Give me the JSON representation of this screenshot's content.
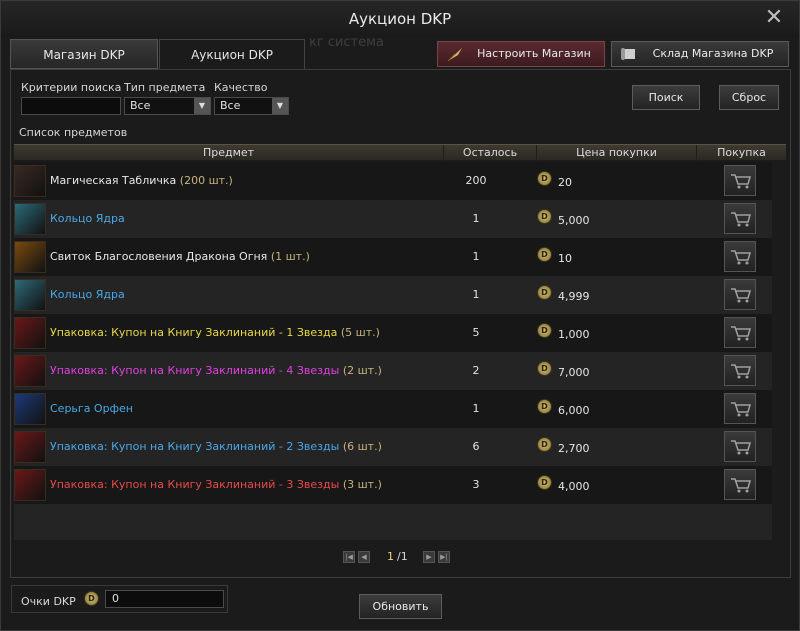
{
  "window": {
    "title": "Аукцион DKP"
  },
  "tabs": [
    {
      "label": "Магазин DKP"
    },
    {
      "label": "Аукцион DKP"
    }
  ],
  "ghost_text": "кг система",
  "toolbar": {
    "setup_label": "Настроить Магазин",
    "warehouse_label": "Склад Магазина DKP"
  },
  "filters": {
    "search_label": "Критерии поиска",
    "search_value": "",
    "type_label": "Тип предмета",
    "type_value": "Все",
    "quality_label": "Качество",
    "quality_value": "Все",
    "search_button": "Поиск",
    "reset_button": "Сброс"
  },
  "list": {
    "caption": "Список предметов",
    "headers": {
      "item": "Предмет",
      "remaining": "Осталось",
      "price": "Цена покупки",
      "buy": "Покупка"
    },
    "coin_symbol": "D",
    "rows": [
      {
        "name": "Магическая Табличка",
        "count": "(200 шт.)",
        "remaining": "200",
        "price": "20",
        "color": "#e8e8e8",
        "icon": "magic-tablet-icon",
        "icon_bg": "#3a2a22"
      },
      {
        "name": "Кольцо Ядра",
        "count": "",
        "remaining": "1",
        "price": "5,000",
        "color": "#4aa8e8",
        "icon": "core-ring-icon",
        "icon_bg": "#2c6a78"
      },
      {
        "name": "Свиток Благословения Дракона Огня",
        "count": "(1 шт.)",
        "remaining": "1",
        "price": "10",
        "color": "#e8e8e8",
        "icon": "fire-dragon-scroll-icon",
        "icon_bg": "#7a4a10"
      },
      {
        "name": "Кольцо Ядра",
        "count": "",
        "remaining": "1",
        "price": "4,999",
        "color": "#4aa8e8",
        "icon": "core-ring-icon",
        "icon_bg": "#2c6a78"
      },
      {
        "name": "Упаковка: Купон на Книгу Заклинаний - 1 Звезда",
        "count": "(5 шт.)",
        "remaining": "5",
        "price": "1,000",
        "color": "#e8d84a",
        "icon": "spellbook-coupon-icon",
        "icon_bg": "#6a1818"
      },
      {
        "name": "Упаковка: Купон на Книгу Заклинаний - 4 Звезды",
        "count": "(2 шт.)",
        "remaining": "2",
        "price": "7,000",
        "color": "#e040e0",
        "icon": "spellbook-coupon-icon",
        "icon_bg": "#6a1818"
      },
      {
        "name": "Серьга Орфен",
        "count": "",
        "remaining": "1",
        "price": "6,000",
        "color": "#4aa8e8",
        "icon": "orfen-earring-icon",
        "icon_bg": "#1e3a78"
      },
      {
        "name": "Упаковка: Купон на Книгу Заклинаний - 2 Звезды",
        "count": "(6 шт.)",
        "remaining": "6",
        "price": "2,700",
        "color": "#4aa8e8",
        "icon": "spellbook-coupon-icon",
        "icon_bg": "#6a1818"
      },
      {
        "name": "Упаковка: Купон на Книгу Заклинаний - 3 Звезды",
        "count": "(3 шт.)",
        "remaining": "3",
        "price": "4,000",
        "color": "#e84a4a",
        "icon": "spellbook-coupon-icon",
        "icon_bg": "#6a1818"
      }
    ]
  },
  "pagination": {
    "current": "1",
    "total": "/1"
  },
  "footer": {
    "dkp_label": "Очки DKP",
    "dkp_value": "0",
    "refresh_button": "Обновить"
  }
}
